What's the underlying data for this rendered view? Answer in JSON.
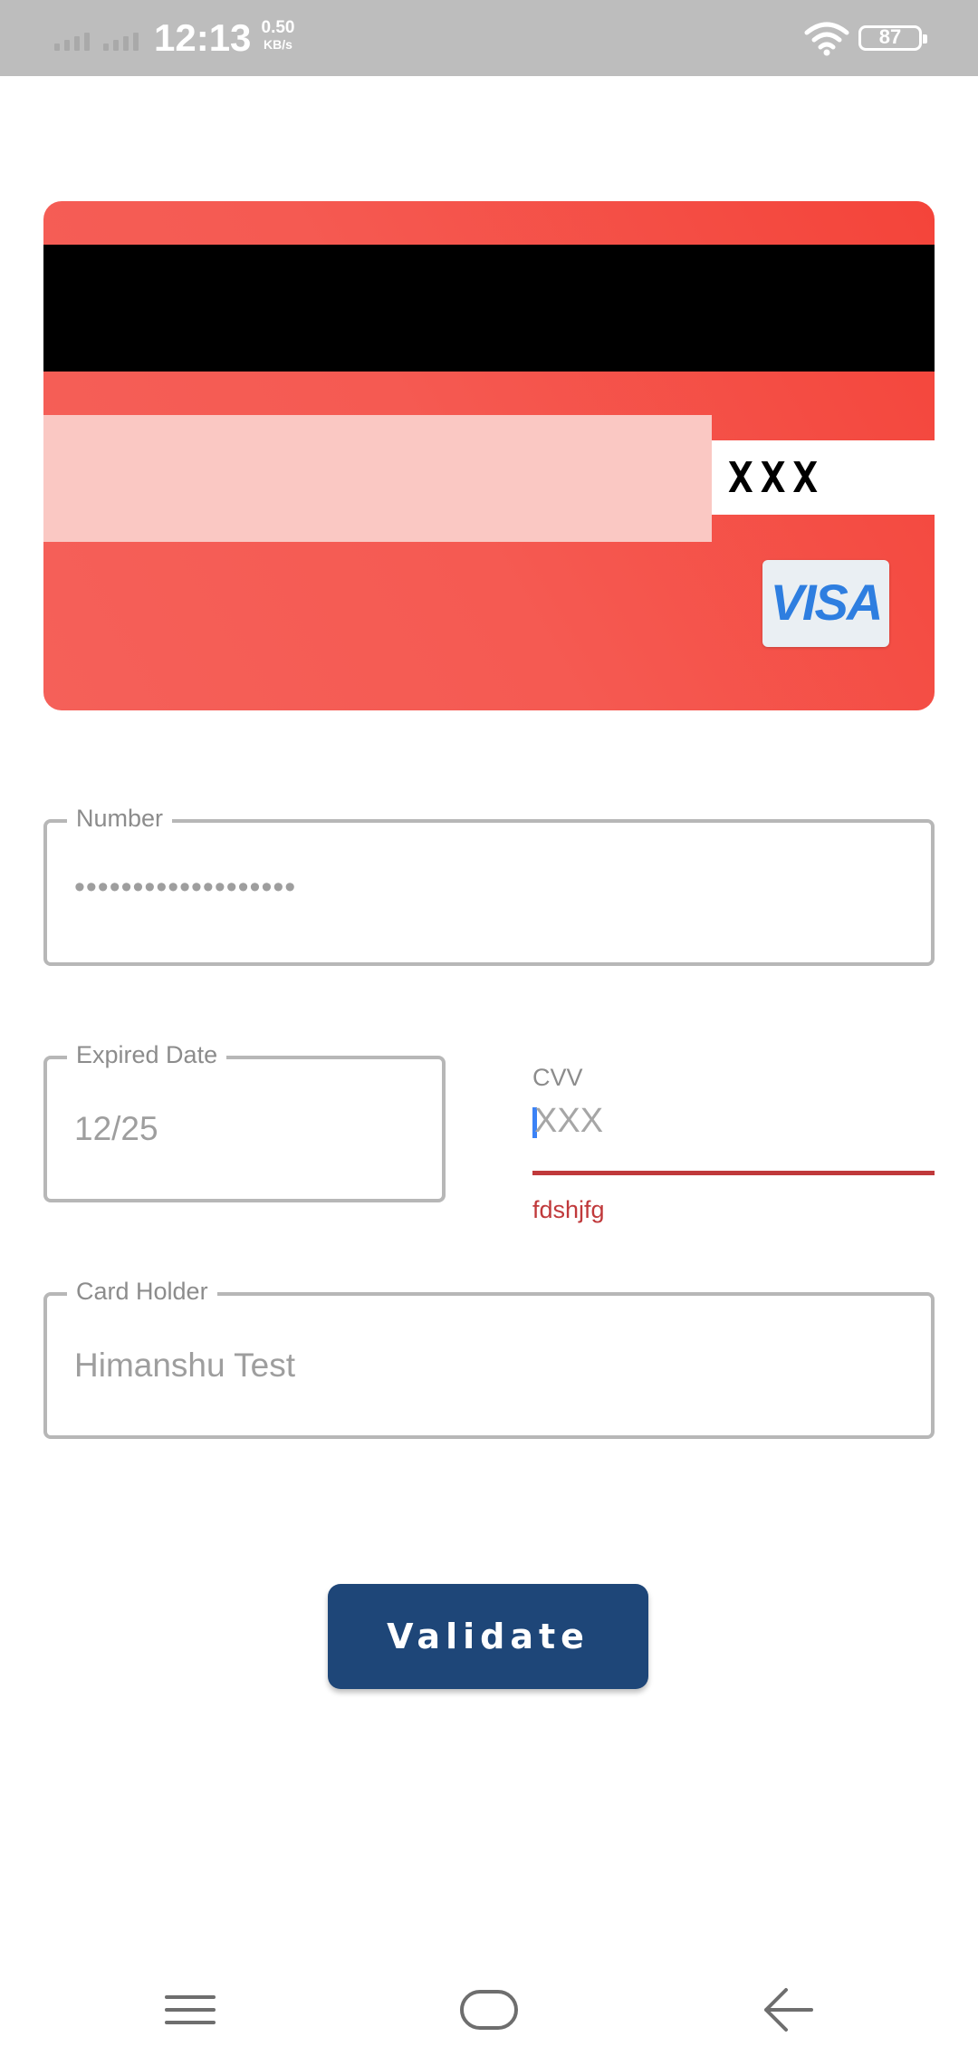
{
  "status_bar": {
    "time": "12:13",
    "net_speed_value": "0.50",
    "net_speed_unit": "KB/s",
    "battery": "87",
    "icons": [
      "signal-icon",
      "signal-icon",
      "wifi-icon",
      "battery-icon"
    ]
  },
  "card": {
    "cvv_display": "XXX",
    "brand": "VISA",
    "colors": {
      "card_start": "#f56059",
      "card_end": "#f4443a",
      "stripe": "#000000",
      "signature_panel": "#fac8c3",
      "brand_text": "#2e7ee0"
    }
  },
  "form": {
    "number": {
      "label": "Number",
      "value": "•••••••••••••••••••"
    },
    "expiry": {
      "label": "Expired Date",
      "value": "12/25"
    },
    "cvv": {
      "label": "CVV",
      "placeholder": "XXX",
      "error": "fdshjfg",
      "error_color": "#c0393b"
    },
    "holder": {
      "label": "Card Holder",
      "value": "Himanshu Test"
    }
  },
  "actions": {
    "validate_label": "Validate",
    "button_color": "#1e4678"
  },
  "nav_bar": {
    "icons": [
      "menu-icon",
      "home-icon",
      "back-icon"
    ]
  }
}
